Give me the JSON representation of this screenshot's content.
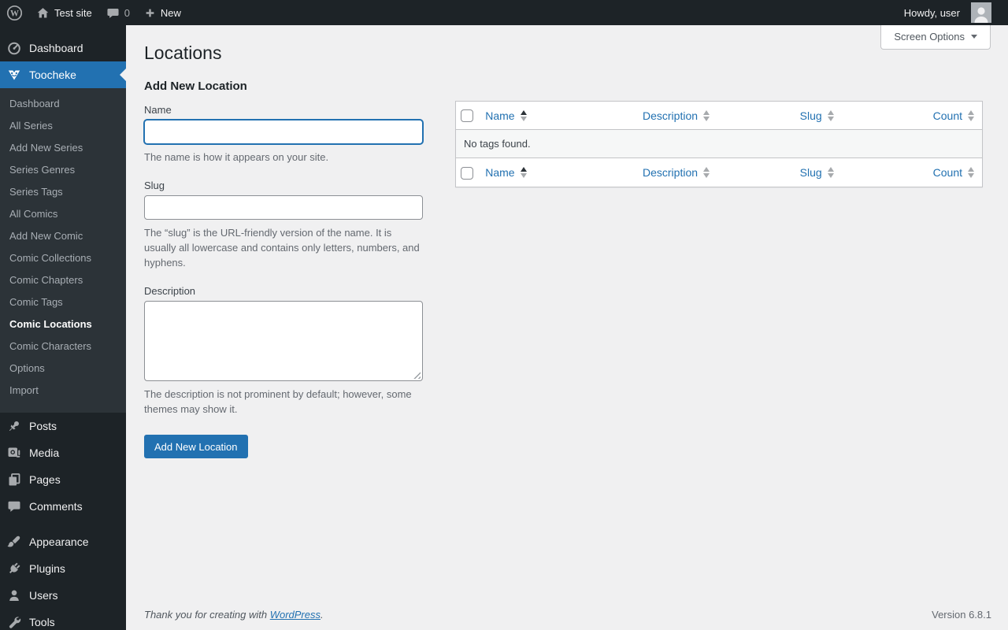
{
  "colors": {
    "accent_blue": "#2271b1",
    "admin_bar_bg": "#1d2327",
    "submenu_bg": "#2c3338",
    "content_bg": "#f0f0f1",
    "border": "#c3c4c7",
    "help_text": "#646970"
  },
  "admin_bar": {
    "site_name": "Test site",
    "comment_count": "0",
    "new_label": "New",
    "howdy_text": "Howdy, user"
  },
  "sidebar": {
    "dashboard_label": "Dashboard",
    "toocheke_label": "Toocheke",
    "toocheke_submenu": [
      "Dashboard",
      "All Series",
      "Add New Series",
      "Series Genres",
      "Series Tags",
      "All Comics",
      "Add New Comic",
      "Comic Collections",
      "Comic Chapters",
      "Comic Tags",
      "Comic Locations",
      "Comic Characters",
      "Options",
      "Import"
    ],
    "current_submenu_item": "Comic Locations",
    "posts_label": "Posts",
    "media_label": "Media",
    "pages_label": "Pages",
    "comments_label": "Comments",
    "appearance_label": "Appearance",
    "plugins_label": "Plugins",
    "users_label": "Users",
    "tools_label": "Tools"
  },
  "page": {
    "title": "Locations",
    "screen_options_label": "Screen Options"
  },
  "form": {
    "heading": "Add New Location",
    "name": {
      "label": "Name",
      "value": "",
      "help": "The name is how it appears on your site."
    },
    "slug": {
      "label": "Slug",
      "value": "",
      "help": "The “slug” is the URL-friendly version of the name. It is usually all lowercase and contains only letters, numbers, and hyphens."
    },
    "description": {
      "label": "Description",
      "value": "",
      "help": "The description is not prominent by default; however, some themes may show it."
    },
    "submit_label": "Add New Location"
  },
  "table": {
    "columns": {
      "name": "Name",
      "description": "Description",
      "slug": "Slug",
      "count": "Count"
    },
    "sorted_column": "Name",
    "sort_order": "ascending",
    "empty_message": "No tags found."
  },
  "footer": {
    "thanks_prefix": "Thank you for creating with ",
    "wordpress_link": "WordPress",
    "thanks_suffix": ".",
    "version": "Version 6.8.1"
  }
}
